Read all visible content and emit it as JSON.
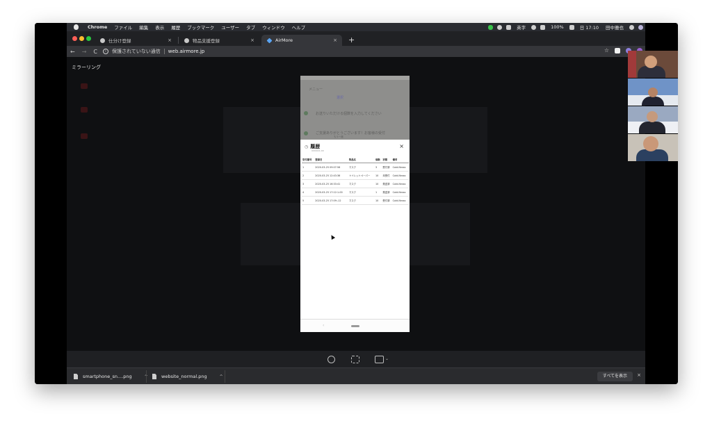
{
  "menubar": {
    "items": [
      "Chrome",
      "ファイル",
      "編集",
      "表示",
      "履歴",
      "ブックマーク",
      "ユーザー",
      "タブ",
      "ウィンドウ",
      "ヘルプ"
    ],
    "input_source": "英字",
    "battery": "100%",
    "clock": "日 17:10",
    "user": "田中雅也"
  },
  "tabs": [
    {
      "title": "仕分け登録",
      "close": "×"
    },
    {
      "title": "物品支援登録",
      "close": "×"
    },
    {
      "title": "AirMore",
      "close": "×"
    }
  ],
  "newtab": "+",
  "toolbar": {
    "back": "←",
    "forward": "→",
    "reload": "C",
    "security": "保護されていない通信",
    "url": "web.airmore.jp",
    "bookmark": "☆"
  },
  "content": {
    "title": "ミラーリング"
  },
  "phone": {
    "dimmed": {
      "header": "メニュー",
      "tab": "選択",
      "msg1": "お送りいただける個数を入力してください",
      "msg2": "ご支援ありがとうございます！お客様の受付",
      "msg3": "もう一度"
    },
    "sheet": {
      "clock_icon": "◷",
      "title": "履歴",
      "subtitle": "xxxxxx-xx",
      "close": "×",
      "columns": [
        "受付番号",
        "登録日",
        "物品名",
        "個数",
        "状態",
        "備考"
      ],
      "rows": [
        [
          "1",
          "2020-03-25 09:07:56",
          "マスク",
          "3",
          "受付済",
          "Coid-Nnsss"
        ],
        [
          "2",
          "2020-03-25 12:43:36",
          "トイレットペーパー",
          "10",
          "未受付",
          "Cold-Nnsss"
        ],
        [
          "3",
          "2020-03-25 16:33:41",
          "マスク",
          "10",
          "発送済",
          "Cold-Nnsss"
        ],
        [
          "4",
          "2020-03-25 17:12:1-00",
          "マスク",
          "1",
          "発送済",
          "Cold-Nnsss"
        ],
        [
          "5",
          "2020-03-25 17:09:-12",
          "マスク",
          "10",
          "受付済",
          "Cold-Nnsss"
        ]
      ],
      "nav_back": "‹"
    }
  },
  "controls": {
    "cast_arrow": "⌄"
  },
  "downloads": [
    {
      "filename": "smartphone_sn....png",
      "chevron": "^"
    },
    {
      "filename": "website_normal.png",
      "chevron": "^"
    }
  ],
  "download_shelf": {
    "show_all": "すべてを表示",
    "close": "×"
  },
  "colors": {
    "traffic_red": "#ff5f57",
    "traffic_yellow": "#febc2e",
    "traffic_green": "#28c840"
  }
}
